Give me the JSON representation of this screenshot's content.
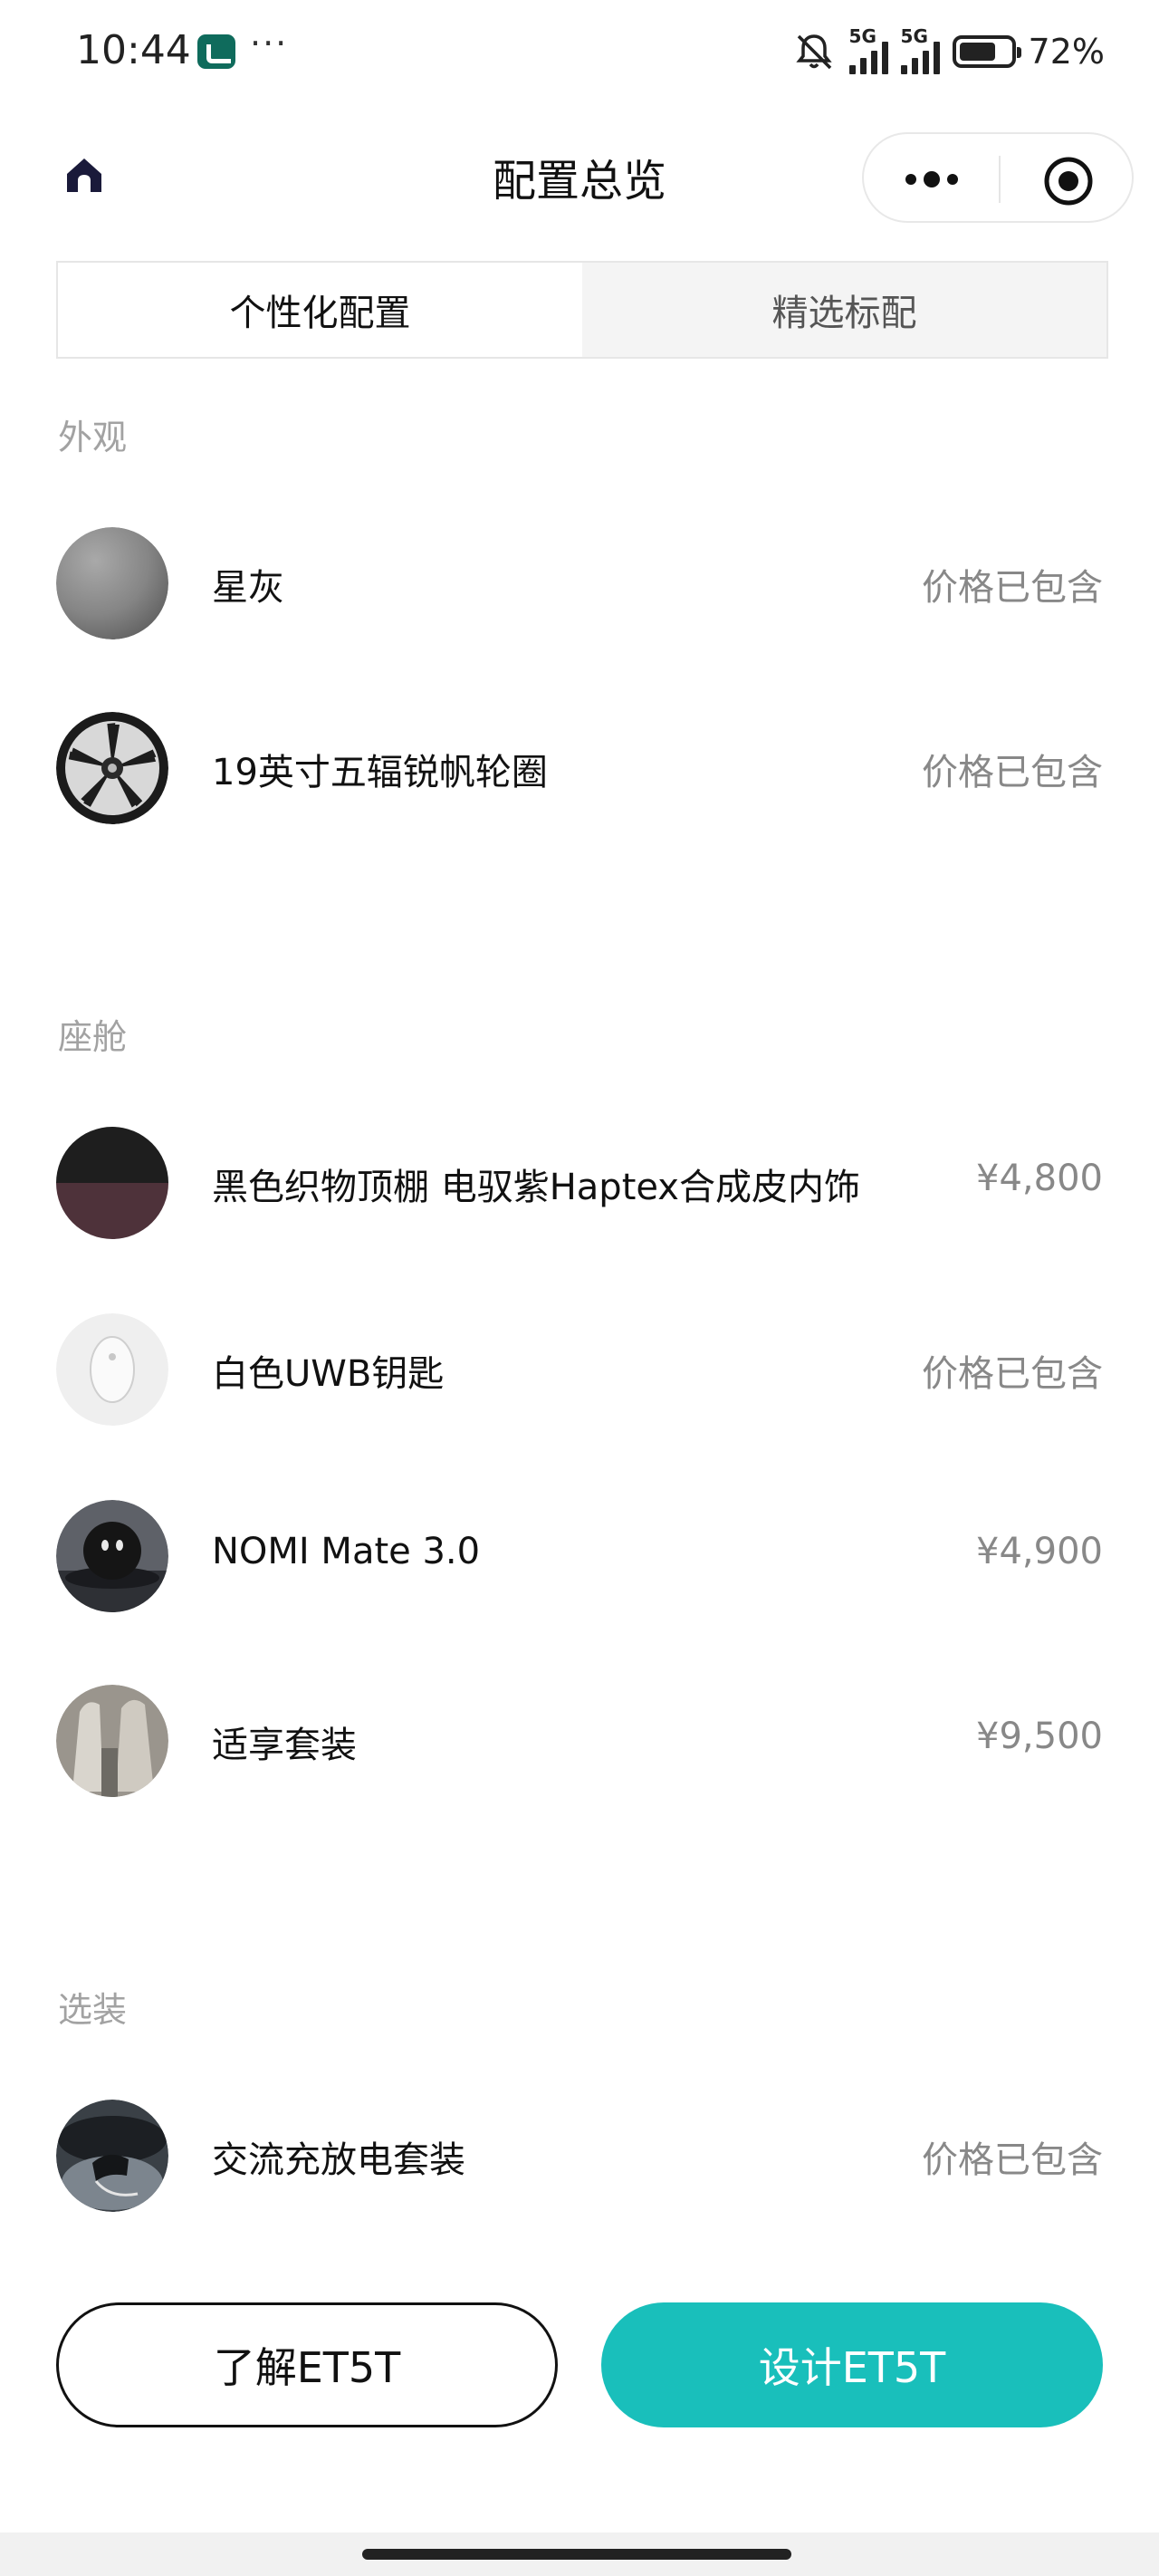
{
  "status_bar": {
    "time": "10:44",
    "dots": "···",
    "signal1_label": "5G",
    "signal2_label": "5G",
    "battery_percent": "72%",
    "battery_level": 0.72
  },
  "nav": {
    "title": "配置总览",
    "home_icon": "home-icon",
    "more_icon": "more-icon",
    "close_icon": "target-icon"
  },
  "tabs": [
    {
      "label": "个性化配置",
      "active": true
    },
    {
      "label": "精选标配",
      "active": false
    }
  ],
  "sections": [
    {
      "header": "外观",
      "items": [
        {
          "name": "星灰",
          "price": "价格已包含"
        },
        {
          "name": "19英寸五辐锐帆轮圈",
          "price": "价格已包含"
        }
      ]
    },
    {
      "header": "座舱",
      "items": [
        {
          "name": "黑色织物顶棚 电驭紫Haptex合成皮内饰",
          "price": "¥4,800"
        },
        {
          "name": "白色UWB钥匙",
          "price": "价格已包含"
        },
        {
          "name": "NOMI Mate 3.0",
          "price": "¥4,900"
        },
        {
          "name": "适享套装",
          "price": "¥9,500"
        }
      ]
    },
    {
      "header": "选装",
      "items": [
        {
          "name": "交流充放电套装",
          "price": "价格已包含"
        }
      ]
    }
  ],
  "buttons": {
    "learn": "了解ET5T",
    "design": "设计ET5T"
  },
  "colors": {
    "accent": "#19bfbb",
    "muted_text": "#888888",
    "section_header": "#a2a2a2"
  }
}
